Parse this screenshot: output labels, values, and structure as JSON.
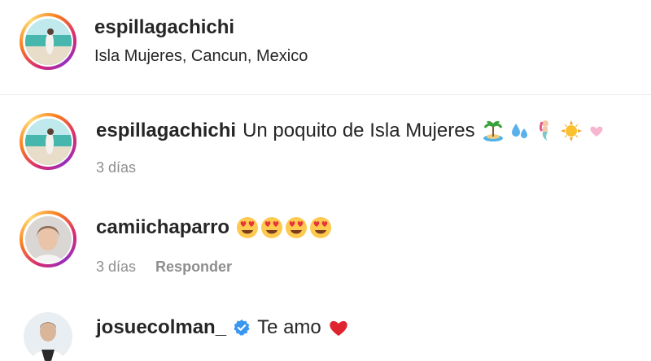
{
  "post_header": {
    "username": "espillagachichi",
    "location": "Isla Mujeres, Cancun, Mexico"
  },
  "comments": [
    {
      "username": "espillagachichi",
      "text": "Un poquito de Isla Mujeres",
      "emojis": [
        "island-emoji",
        "droplets-emoji",
        "mermaid-emoji",
        "sun-emoji",
        "pink-heart-emoji"
      ],
      "time": "3 días"
    },
    {
      "username": "camiichaparro",
      "text": "",
      "emojis": [
        "heart-eyes-emoji",
        "heart-eyes-emoji",
        "heart-eyes-emoji",
        "heart-eyes-emoji"
      ],
      "time": "3 días",
      "reply_label": "Responder"
    },
    {
      "username": "josuecolman_",
      "verified": true,
      "text": "Te amo",
      "emojis": [
        "red-heart-emoji"
      ]
    }
  ],
  "colors": {
    "ring_start": "#d62976",
    "ring_mid": "#fa7e1e",
    "ring_end": "#feda75",
    "verified": "#3897f0",
    "meta": "#8e8e8e",
    "text": "#262626"
  }
}
